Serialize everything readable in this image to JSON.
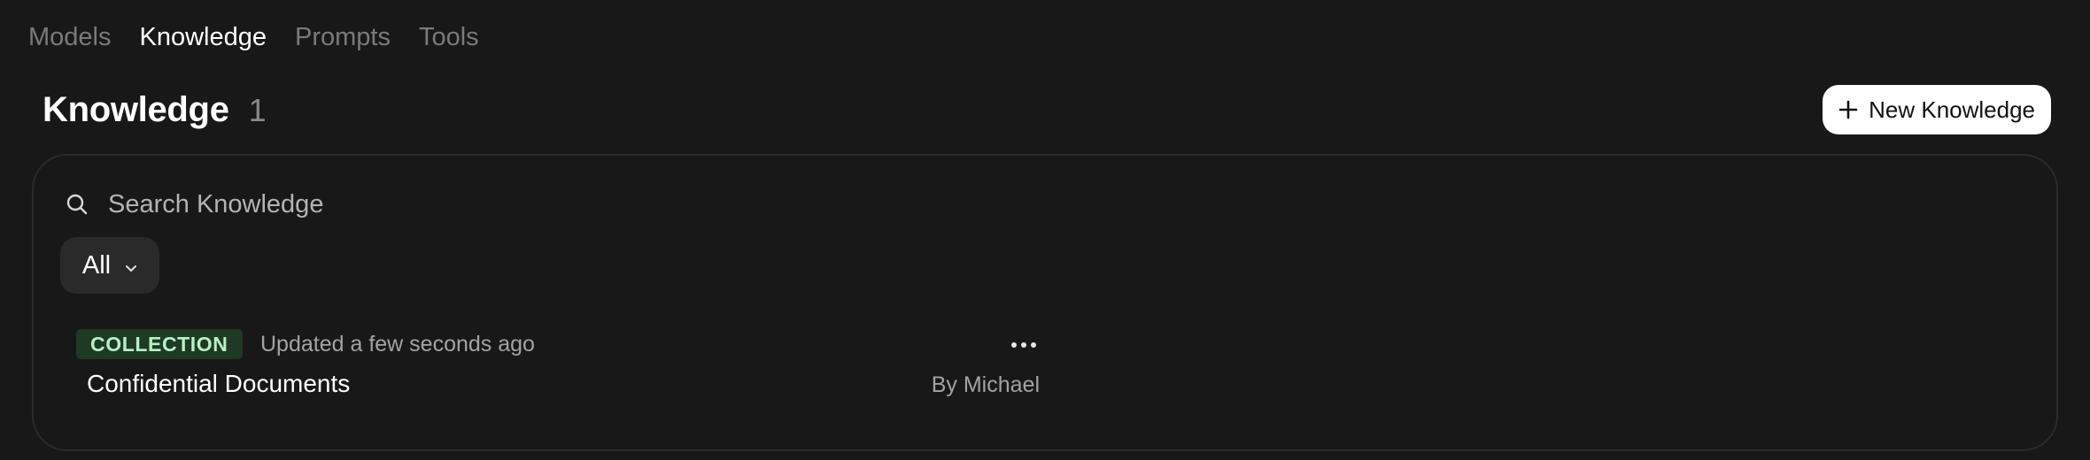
{
  "nav": {
    "tabs": [
      {
        "label": "Models",
        "active": false
      },
      {
        "label": "Knowledge",
        "active": true
      },
      {
        "label": "Prompts",
        "active": false
      },
      {
        "label": "Tools",
        "active": false
      }
    ]
  },
  "header": {
    "title": "Knowledge",
    "count": "1",
    "new_button_label": "New Knowledge",
    "new_button_icon": "plus-icon"
  },
  "search": {
    "placeholder": "Search Knowledge",
    "value": "",
    "icon": "search-icon"
  },
  "filter": {
    "selected": "All",
    "icon": "chevron-down-icon"
  },
  "items": [
    {
      "badge": "COLLECTION",
      "updated": "Updated a few seconds ago",
      "title": "Confidential Documents",
      "author": "By Michael",
      "menu_icon": "ellipsis-icon"
    }
  ],
  "colors": {
    "background": "#181818",
    "badge_bg": "#1f3a24",
    "badge_text": "#b9efc5",
    "button_bg": "#ffffff"
  }
}
